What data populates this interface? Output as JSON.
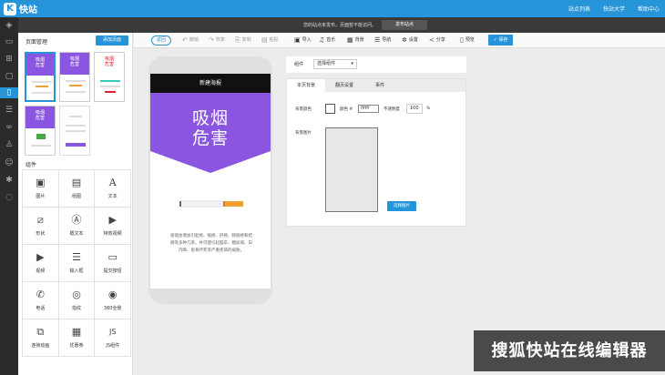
{
  "app": {
    "logo_letter": "K",
    "name": "快站"
  },
  "top_links": [
    "站点列表",
    "快站大学",
    "帮助中心"
  ],
  "notice": {
    "text": "您的站点未发布，页面暂不能访问。",
    "publish_label": "发布站点"
  },
  "rail_icons": [
    "layers-icon",
    "page-icon",
    "cart-icon",
    "chat-icon",
    "phone-icon",
    "list-icon",
    "link-icon",
    "user-icon",
    "person-icon",
    "gear-icon",
    "chat-bubble-icon"
  ],
  "pages": {
    "title": "页面管理",
    "add_label": "添加页面",
    "thumbs": [
      {
        "line1": "吸烟",
        "line2": "危害"
      },
      {
        "line1": "吸烟",
        "line2": "危害"
      },
      {
        "line1": "吸烟",
        "line2": "危害"
      },
      {
        "line1": "吸烟",
        "line2": "危害"
      }
    ]
  },
  "components": {
    "title": "组件",
    "items": [
      {
        "label": "图片",
        "icon": "image-icon",
        "glyph": "▣"
      },
      {
        "label": "组图",
        "icon": "gallery-icon",
        "glyph": "▤"
      },
      {
        "label": "文本",
        "icon": "text-icon",
        "glyph": "A"
      },
      {
        "label": "形状",
        "icon": "shape-icon",
        "glyph": "⧄"
      },
      {
        "label": "概文本",
        "icon": "rich-text-icon",
        "glyph": "Ⓐ"
      },
      {
        "label": "特效视频",
        "icon": "effect-video-icon",
        "glyph": "▶"
      },
      {
        "label": "视频",
        "icon": "video-icon",
        "glyph": "▶"
      },
      {
        "label": "输入框",
        "icon": "input-icon",
        "glyph": "☰"
      },
      {
        "label": "提交按钮",
        "icon": "submit-icon",
        "glyph": "▭"
      },
      {
        "label": "电话",
        "icon": "phone-icon",
        "glyph": "✆"
      },
      {
        "label": "指纹",
        "icon": "fingerprint-icon",
        "glyph": "◎"
      },
      {
        "label": "360全景",
        "icon": "panorama-icon",
        "glyph": "◉"
      },
      {
        "label": "连帧动画",
        "icon": "frame-animation-icon",
        "glyph": "⧉"
      },
      {
        "label": "优惠券",
        "icon": "coupon-icon",
        "glyph": "▦"
      },
      {
        "label": "JS组件",
        "icon": "js-icon",
        "glyph": "JS"
      }
    ]
  },
  "toolbar": {
    "back": "返回",
    "undo": "撤销",
    "redo": "恢复",
    "copy": "复制",
    "paste": "粘贴",
    "import": "导入",
    "music": "音乐",
    "background": "背景",
    "nav": "导航",
    "settings": "设置",
    "share": "分享",
    "preview": "预览",
    "save": "保存"
  },
  "phone": {
    "header": "新建海报",
    "title_line1": "吸烟",
    "title_line2": "危害",
    "body": "吸烟会增加引起癌、喉癌、肝癌、膀胱癌和结肠等多种几率。并可使引起脑卒、糖尿病、白内障、股骨坏死等严重疾病的威胁。",
    "accent": "#8a55e0"
  },
  "props": {
    "component_label": "组件",
    "component_select": "选择组件",
    "tabs": [
      "本页背景",
      "翻页设置",
      "事件"
    ],
    "bg_color_label": "背景颜色",
    "color_label": "颜色 #",
    "color_value": "ffffff",
    "opacity_label": "不透明度",
    "opacity_value": "100",
    "opacity_unit": "%",
    "bg_image_label": "背景图片",
    "choose_image": "选择图片"
  },
  "watermark": "搜狐快站在线编辑器"
}
